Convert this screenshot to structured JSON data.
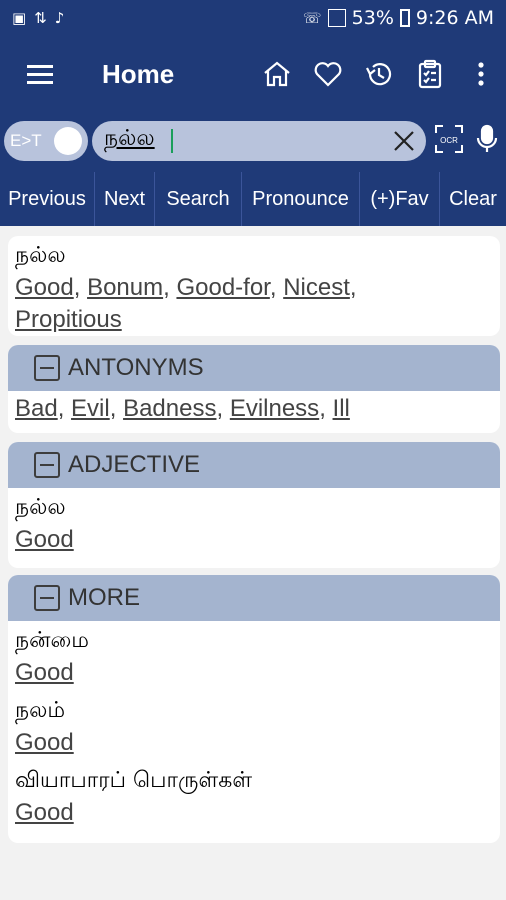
{
  "status": {
    "battery": "53%",
    "time": "9:26 AM"
  },
  "app_bar": {
    "title": "Home",
    "icons": [
      "home-icon",
      "heart-icon",
      "history-icon",
      "clipboard-icon",
      "more-vert-icon"
    ]
  },
  "search": {
    "mode_label": "E>T",
    "query": "நல்ல"
  },
  "toolbar": {
    "previous": "Previous",
    "next": "Next",
    "search": "Search",
    "pronounce": "Pronounce",
    "fav": "(+)Fav",
    "clear": "Clear"
  },
  "main_result": {
    "tamil": "நல்ல",
    "translations": [
      "Good",
      "Bonum",
      "Good-for",
      "Nicest",
      "Propitious"
    ]
  },
  "antonyms": {
    "label": "ANTONYMS",
    "words": [
      "Bad",
      "Evil",
      "Badness",
      "Evilness",
      "Ill"
    ]
  },
  "adjective": {
    "label": "ADJECTIVE",
    "tamil": "நல்ல",
    "translation": "Good"
  },
  "more": {
    "label": "MORE",
    "entries": [
      {
        "tamil": "நன்மை",
        "translation": "Good"
      },
      {
        "tamil": "நலம்",
        "translation": "Good"
      },
      {
        "tamil": "வியாபாரப் பொருள்கள்",
        "translation": "Good"
      }
    ]
  },
  "colors": {
    "primary": "#1f3a78",
    "section_header": "#a4b4cf",
    "background": "#f2f2f2"
  }
}
